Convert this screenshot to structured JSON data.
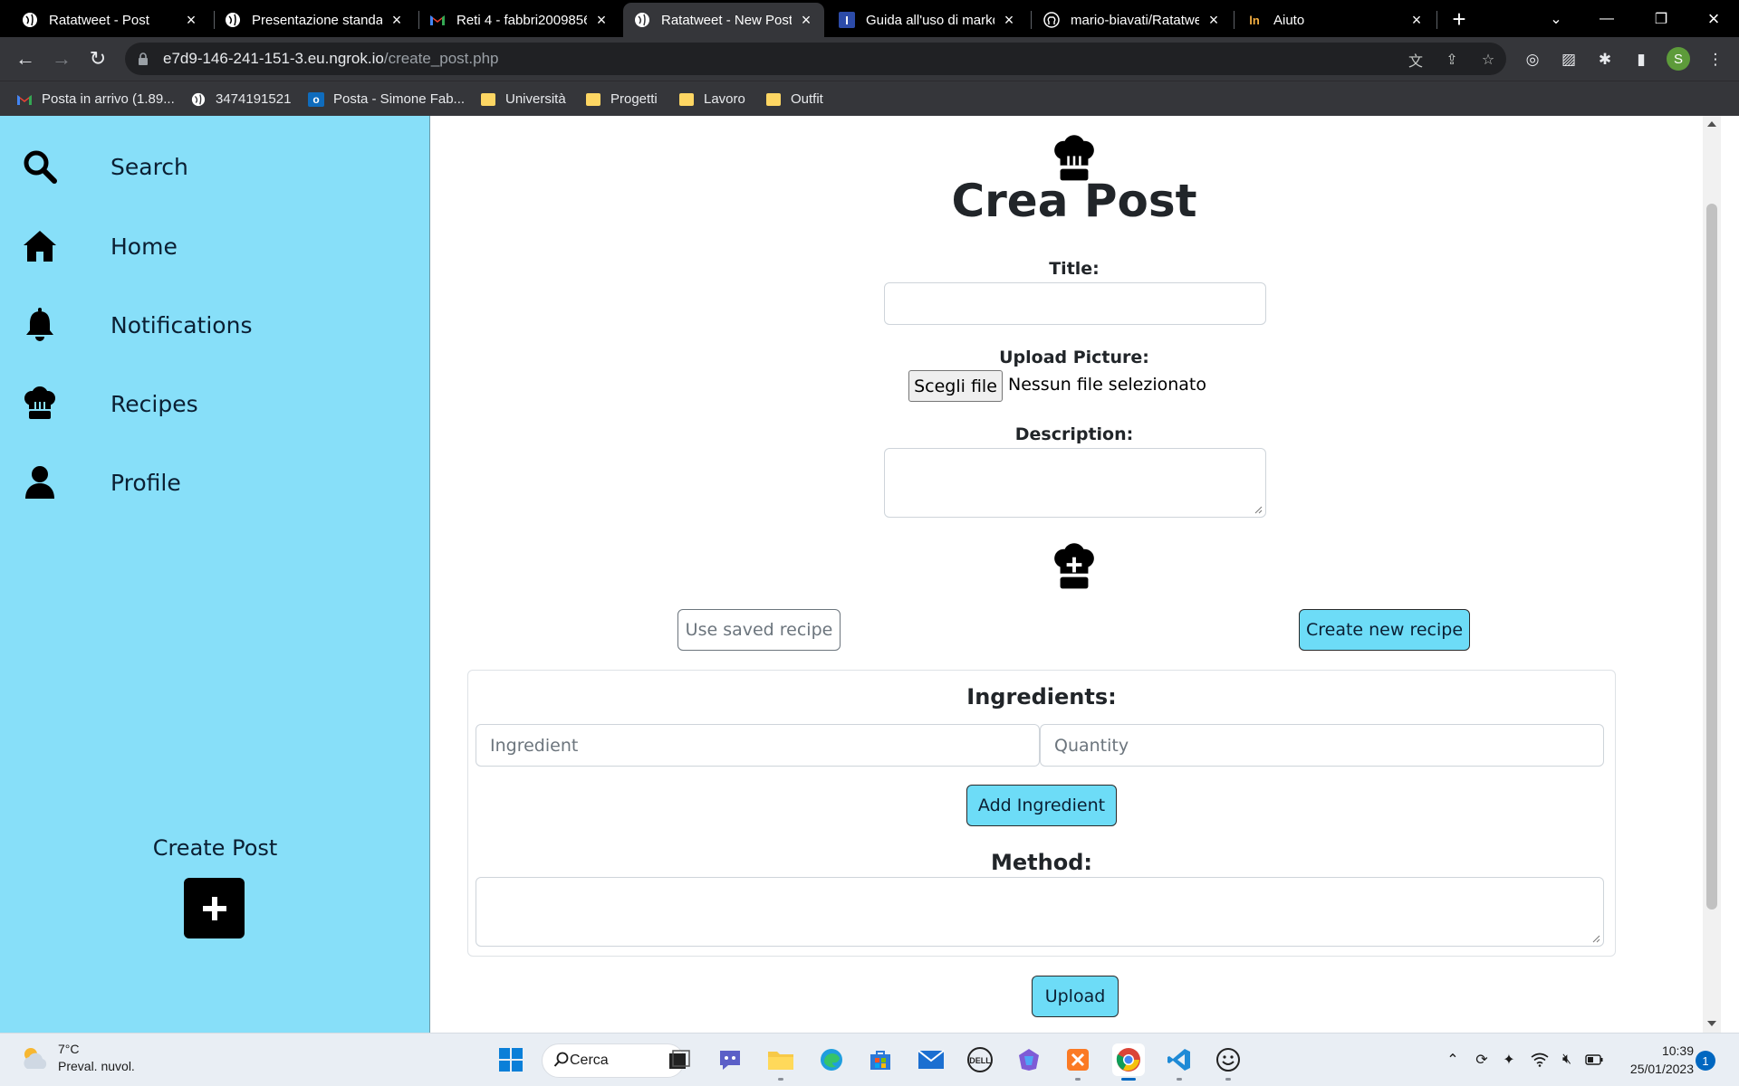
{
  "browser": {
    "tabs": [
      {
        "title": "Ratatweet - Post",
        "icon": "globe-icon"
      },
      {
        "title": "Presentazione standard",
        "icon": "globe-icon"
      },
      {
        "title": "Reti 4 - fabbri2009856",
        "icon": "gmail-icon"
      },
      {
        "title": "Ratatweet - New Post",
        "icon": "globe-icon",
        "active": true
      },
      {
        "title": "Guida all'uso di markdown",
        "icon": "doc-icon"
      },
      {
        "title": "mario-biavati/Ratatweet",
        "icon": "github-icon"
      },
      {
        "title": "Aiuto",
        "icon": "help-icon"
      }
    ],
    "url_host": "e7d9-146-241-151-3.eu.ngrok.io",
    "url_path": "/create_post.php",
    "profile_initial": "S",
    "bookmarks": [
      {
        "label": "Posta in arrivo (1.89...",
        "icon": "gmail-icon"
      },
      {
        "label": "3474191521",
        "icon": "globe-icon"
      },
      {
        "label": "Posta - Simone Fab...",
        "icon": "outlook-icon"
      },
      {
        "label": "Università",
        "icon": "folder-icon"
      },
      {
        "label": "Progetti",
        "icon": "folder-icon"
      },
      {
        "label": "Lavoro",
        "icon": "folder-icon"
      },
      {
        "label": "Outfit",
        "icon": "folder-icon"
      }
    ]
  },
  "sidebar": {
    "items": [
      {
        "label": "Search",
        "icon": "search-icon"
      },
      {
        "label": "Home",
        "icon": "home-icon"
      },
      {
        "label": "Notifications",
        "icon": "bell-icon"
      },
      {
        "label": "Recipes",
        "icon": "chef-hat-icon"
      },
      {
        "label": "Profile",
        "icon": "user-icon"
      }
    ],
    "create_post_label": "Create Post"
  },
  "form": {
    "page_title": "Crea Post",
    "title_label": "Title:",
    "title_value": "",
    "upload_label": "Upload Picture:",
    "file_button": "Scegli file",
    "file_status": "Nessun file selezionato",
    "description_label": "Description:",
    "description_value": "",
    "use_saved_recipe": "Use saved recipe",
    "create_new_recipe": "Create new recipe",
    "ingredients_title": "Ingredients:",
    "ingredient_placeholder": "Ingredient",
    "quantity_placeholder": "Quantity",
    "add_ingredient": "Add Ingredient",
    "method_title": "Method:",
    "method_value": "",
    "upload_button": "Upload"
  },
  "taskbar": {
    "temperature": "7°C",
    "weather_text": "Preval. nuvol.",
    "search_label": "Cerca",
    "time": "10:39",
    "date": "25/01/2023",
    "notification_count": "1"
  },
  "colors": {
    "sidebar_bg": "#87dff9",
    "primary_button": "#6ddcf7"
  }
}
